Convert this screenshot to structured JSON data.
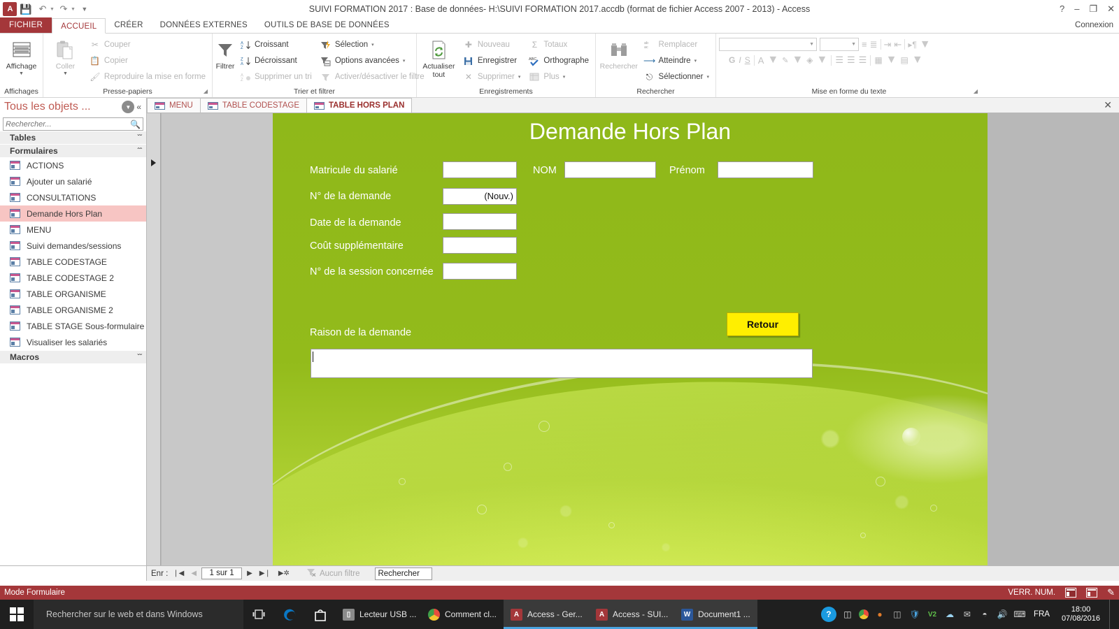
{
  "titlebar": {
    "app_icon": "access-logo-icon",
    "title": "SUIVI FORMATION 2017 : Base de données- H:\\SUIVI FORMATION 2017.accdb (format de fichier Access 2007 - 2013) - Access",
    "help": "?",
    "minimize": "–",
    "restore": "❐",
    "close": "✕"
  },
  "ribbon": {
    "file_tab": "FICHIER",
    "tabs": [
      "ACCUEIL",
      "CRÉER",
      "DONNÉES EXTERNES",
      "OUTILS DE BASE DE DONNÉES"
    ],
    "active_tab": "ACCUEIL",
    "connexion": "Connexion",
    "groups": [
      {
        "title": "Affichages",
        "big": [
          {
            "label": "Affichage",
            "icon": "view-grid-icon",
            "caret": "▼"
          }
        ],
        "small": []
      },
      {
        "title": "Presse-papiers",
        "big": [
          {
            "label": "Coller",
            "icon": "clipboard-icon",
            "caret": "▼"
          }
        ],
        "small": [
          {
            "label": "Couper",
            "icon": "scissors-icon",
            "disabled": true
          },
          {
            "label": "Copier",
            "icon": "copy-icon",
            "disabled": true
          },
          {
            "label": "Reproduire la mise en forme",
            "icon": "format-painter-icon",
            "disabled": true
          }
        ]
      },
      {
        "title": "Trier et filtrer",
        "big": [
          {
            "label": "Filtrer",
            "icon": "funnel-icon",
            "caret": ""
          }
        ],
        "small": [
          {
            "label": "Croissant",
            "icon": "sort-asc-icon",
            "disabled": false
          },
          {
            "label": "Décroissant",
            "icon": "sort-desc-icon",
            "disabled": false
          },
          {
            "label": "Supprimer un tri",
            "icon": "clear-sort-icon",
            "disabled": true
          },
          {
            "label": "Sélection",
            "icon": "selection-filter-icon",
            "disabled": false,
            "caret": "▾"
          },
          {
            "label": "Options avancées",
            "icon": "advanced-filter-icon",
            "disabled": false,
            "caret": "▾"
          },
          {
            "label": "Activer/désactiver le filtre",
            "icon": "toggle-filter-icon",
            "disabled": true
          }
        ]
      },
      {
        "title": "Enregistrements",
        "big": [
          {
            "label": "Actualiser tout",
            "icon": "refresh-icon",
            "caret": "▾"
          }
        ],
        "small": [
          {
            "label": "Nouveau",
            "icon": "new-record-icon",
            "disabled": true
          },
          {
            "label": "Enregistrer",
            "icon": "save-record-icon",
            "disabled": false
          },
          {
            "label": "Supprimer",
            "icon": "delete-record-icon",
            "disabled": true,
            "caret": "▾"
          },
          {
            "label": "Totaux",
            "icon": "sigma-icon",
            "disabled": true
          },
          {
            "label": "Orthographe",
            "icon": "spelling-icon",
            "disabled": false
          },
          {
            "label": "Plus",
            "icon": "more-grid-icon",
            "disabled": true,
            "caret": "▾"
          }
        ]
      },
      {
        "title": "Rechercher",
        "big": [
          {
            "label": "Rechercher",
            "icon": "binoculars-icon",
            "caret": ""
          }
        ],
        "small": [
          {
            "label": "Remplacer",
            "icon": "replace-icon",
            "disabled": true
          },
          {
            "label": "Atteindre",
            "icon": "goto-arrow-icon",
            "disabled": false,
            "caret": "▾"
          },
          {
            "label": "Sélectionner",
            "icon": "select-cursor-icon",
            "disabled": false,
            "caret": "▾"
          }
        ]
      },
      {
        "title": "Mise en forme du texte",
        "font_name": "",
        "font_size": "",
        "buttons": [
          "G",
          "I",
          "S"
        ],
        "icons": [
          "bullet-list-icon",
          "numbered-list-icon",
          "indent-increase-icon",
          "indent-decrease-icon",
          "text-direction-icon",
          "font-color-icon",
          "highlight-icon",
          "fill-color-icon",
          "align-left-icon",
          "align-center-icon",
          "align-right-icon",
          "gridlines-icon",
          "alternate-row-color-icon"
        ]
      }
    ]
  },
  "navpane": {
    "title": "Tous les objets ...",
    "dropdown_icon": "chevron-down-circle-icon",
    "collapse_icon": "double-chevron-left-icon",
    "search_placeholder": "Rechercher...",
    "search_value": "",
    "groups": [
      {
        "label": "Tables",
        "expanded": false,
        "chevron": "ˇˇ",
        "items": []
      },
      {
        "label": "Formulaires",
        "expanded": true,
        "chevron": "ˆˆ",
        "items": [
          {
            "label": "ACTIONS",
            "selected": false
          },
          {
            "label": "Ajouter un salarié",
            "selected": false
          },
          {
            "label": "CONSULTATIONS",
            "selected": false
          },
          {
            "label": "Demande Hors Plan",
            "selected": true
          },
          {
            "label": "MENU",
            "selected": false
          },
          {
            "label": "Suivi demandes/sessions",
            "selected": false
          },
          {
            "label": "TABLE CODESTAGE",
            "selected": false
          },
          {
            "label": "TABLE CODESTAGE 2",
            "selected": false
          },
          {
            "label": "TABLE ORGANISME",
            "selected": false
          },
          {
            "label": "TABLE ORGANISME 2",
            "selected": false
          },
          {
            "label": "TABLE STAGE Sous-formulaire",
            "selected": false
          },
          {
            "label": "Visualiser les salariés",
            "selected": false
          }
        ]
      },
      {
        "label": "Macros",
        "expanded": false,
        "chevron": "ˇˇ",
        "items": []
      }
    ]
  },
  "doctabs": {
    "tabs": [
      {
        "label": "MENU",
        "active": false
      },
      {
        "label": "TABLE CODESTAGE",
        "active": false
      },
      {
        "label": "TABLE HORS PLAN",
        "active": true
      }
    ],
    "close_label": "✕"
  },
  "form": {
    "title": "Demande Hors Plan",
    "background_color": "#8fb81a",
    "fields": [
      {
        "name": "matricule",
        "label": "Matricule du salarié",
        "value": ""
      },
      {
        "name": "nom",
        "label": "NOM",
        "value": ""
      },
      {
        "name": "prenom",
        "label": "Prénom",
        "value": ""
      },
      {
        "name": "numero_demande",
        "label": "N° de la demande",
        "value": "(Nouv.)"
      },
      {
        "name": "date_demande",
        "label": "Date de la demande",
        "value": ""
      },
      {
        "name": "cout_supplementaire",
        "label": "Coût supplémentaire",
        "value": ""
      },
      {
        "name": "numero_session",
        "label": "N° de la session concernée",
        "value": ""
      }
    ],
    "raison_label": "Raison de la demande",
    "raison_value": "",
    "retour_button": "Retour",
    "retour_color": "#ffef00"
  },
  "recordbar": {
    "label": "Enr :",
    "first": "❘◀",
    "prev": "◀",
    "position": "1 sur 1",
    "next": "▶",
    "last": "▶❘",
    "new": "▶✲",
    "filter_status": "Aucun filtre",
    "filter_icon": "filter-off-icon",
    "search_value": "Rechercher"
  },
  "statusbar": {
    "mode": "Mode Formulaire",
    "numlock": "VERR. NUM.",
    "view_icons": [
      "form-view-icon",
      "layout-view-icon",
      "design-view-icon"
    ]
  },
  "taskbar": {
    "start_icon": "windows-logo-icon",
    "search_placeholder": "Rechercher sur le web et dans Windows",
    "taskview_icon": "task-view-icon",
    "pinned": [
      {
        "label": "",
        "icon": "edge-icon",
        "color": "#0a77c4"
      },
      {
        "label": "",
        "icon": "store-icon",
        "color": "#ffffff"
      }
    ],
    "apps": [
      {
        "label": "Lecteur USB ...",
        "icon": "usb-drive-icon",
        "color": "#8a8a8a",
        "active": false
      },
      {
        "label": "Comment cl...",
        "icon": "chrome-icon",
        "color": "#e84d3d",
        "active": false
      },
      {
        "label": "Access - Ger...",
        "icon": "access-icon",
        "color": "#a4373a",
        "active": true
      },
      {
        "label": "Access - SUI...",
        "icon": "access-icon",
        "color": "#a4373a",
        "active": true
      },
      {
        "label": "Document1 ...",
        "icon": "word-icon",
        "color": "#2b579a",
        "active": true
      }
    ],
    "tray": [
      "help-circle-icon",
      "battery-icon",
      "chrome-tray-icon",
      "firefox-tray-icon",
      "monitor-icon",
      "shield-icon",
      "v2-icon",
      "onedrive-icon",
      "mail-icon",
      "network-icon",
      "volume-icon",
      "keyboard-icon"
    ],
    "language": "FRA",
    "time": "18:00",
    "date": "07/08/2016"
  }
}
